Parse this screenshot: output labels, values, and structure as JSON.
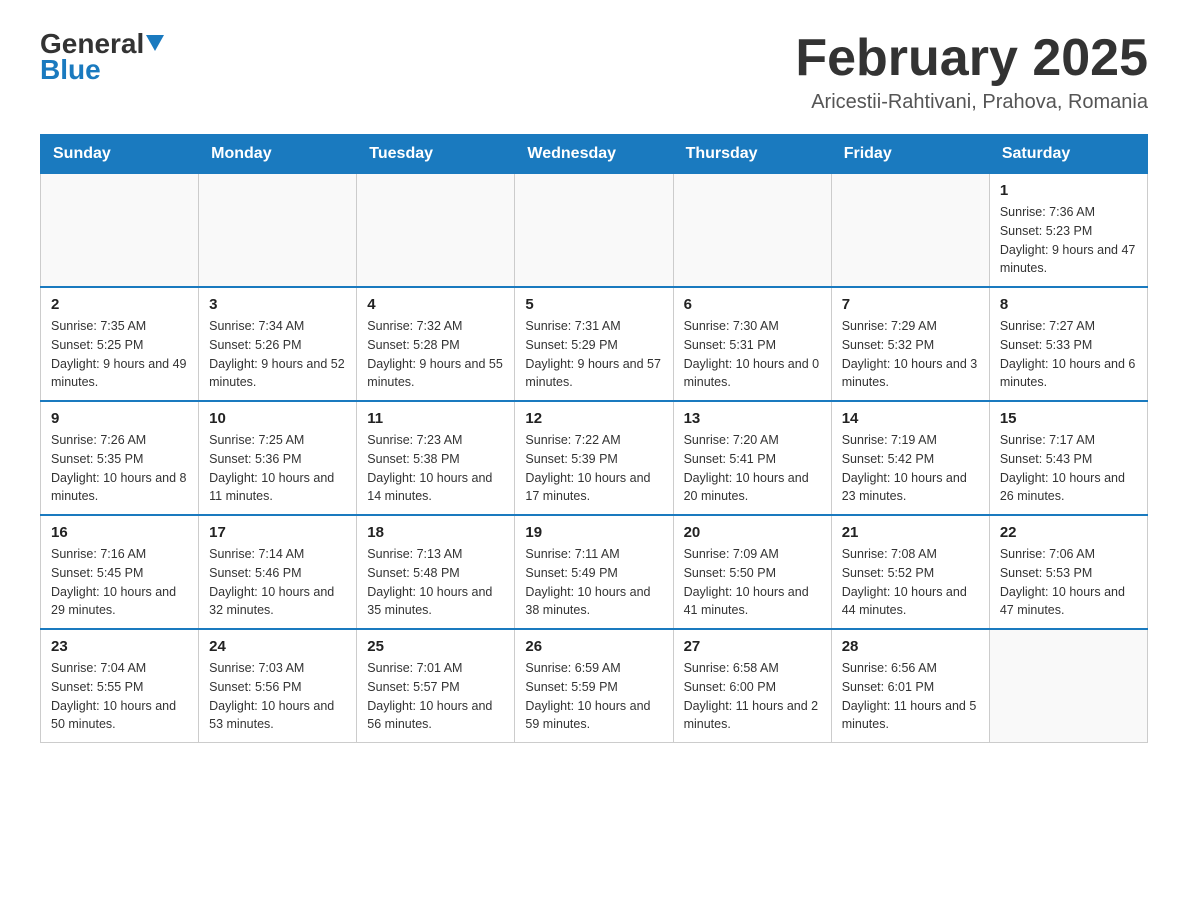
{
  "header": {
    "logo_general": "General",
    "logo_blue": "Blue",
    "month_title": "February 2025",
    "location": "Aricestii-Rahtivani, Prahova, Romania"
  },
  "weekdays": [
    "Sunday",
    "Monday",
    "Tuesday",
    "Wednesday",
    "Thursday",
    "Friday",
    "Saturday"
  ],
  "weeks": [
    [
      {
        "day": "",
        "info": ""
      },
      {
        "day": "",
        "info": ""
      },
      {
        "day": "",
        "info": ""
      },
      {
        "day": "",
        "info": ""
      },
      {
        "day": "",
        "info": ""
      },
      {
        "day": "",
        "info": ""
      },
      {
        "day": "1",
        "info": "Sunrise: 7:36 AM\nSunset: 5:23 PM\nDaylight: 9 hours and 47 minutes."
      }
    ],
    [
      {
        "day": "2",
        "info": "Sunrise: 7:35 AM\nSunset: 5:25 PM\nDaylight: 9 hours and 49 minutes."
      },
      {
        "day": "3",
        "info": "Sunrise: 7:34 AM\nSunset: 5:26 PM\nDaylight: 9 hours and 52 minutes."
      },
      {
        "day": "4",
        "info": "Sunrise: 7:32 AM\nSunset: 5:28 PM\nDaylight: 9 hours and 55 minutes."
      },
      {
        "day": "5",
        "info": "Sunrise: 7:31 AM\nSunset: 5:29 PM\nDaylight: 9 hours and 57 minutes."
      },
      {
        "day": "6",
        "info": "Sunrise: 7:30 AM\nSunset: 5:31 PM\nDaylight: 10 hours and 0 minutes."
      },
      {
        "day": "7",
        "info": "Sunrise: 7:29 AM\nSunset: 5:32 PM\nDaylight: 10 hours and 3 minutes."
      },
      {
        "day": "8",
        "info": "Sunrise: 7:27 AM\nSunset: 5:33 PM\nDaylight: 10 hours and 6 minutes."
      }
    ],
    [
      {
        "day": "9",
        "info": "Sunrise: 7:26 AM\nSunset: 5:35 PM\nDaylight: 10 hours and 8 minutes."
      },
      {
        "day": "10",
        "info": "Sunrise: 7:25 AM\nSunset: 5:36 PM\nDaylight: 10 hours and 11 minutes."
      },
      {
        "day": "11",
        "info": "Sunrise: 7:23 AM\nSunset: 5:38 PM\nDaylight: 10 hours and 14 minutes."
      },
      {
        "day": "12",
        "info": "Sunrise: 7:22 AM\nSunset: 5:39 PM\nDaylight: 10 hours and 17 minutes."
      },
      {
        "day": "13",
        "info": "Sunrise: 7:20 AM\nSunset: 5:41 PM\nDaylight: 10 hours and 20 minutes."
      },
      {
        "day": "14",
        "info": "Sunrise: 7:19 AM\nSunset: 5:42 PM\nDaylight: 10 hours and 23 minutes."
      },
      {
        "day": "15",
        "info": "Sunrise: 7:17 AM\nSunset: 5:43 PM\nDaylight: 10 hours and 26 minutes."
      }
    ],
    [
      {
        "day": "16",
        "info": "Sunrise: 7:16 AM\nSunset: 5:45 PM\nDaylight: 10 hours and 29 minutes."
      },
      {
        "day": "17",
        "info": "Sunrise: 7:14 AM\nSunset: 5:46 PM\nDaylight: 10 hours and 32 minutes."
      },
      {
        "day": "18",
        "info": "Sunrise: 7:13 AM\nSunset: 5:48 PM\nDaylight: 10 hours and 35 minutes."
      },
      {
        "day": "19",
        "info": "Sunrise: 7:11 AM\nSunset: 5:49 PM\nDaylight: 10 hours and 38 minutes."
      },
      {
        "day": "20",
        "info": "Sunrise: 7:09 AM\nSunset: 5:50 PM\nDaylight: 10 hours and 41 minutes."
      },
      {
        "day": "21",
        "info": "Sunrise: 7:08 AM\nSunset: 5:52 PM\nDaylight: 10 hours and 44 minutes."
      },
      {
        "day": "22",
        "info": "Sunrise: 7:06 AM\nSunset: 5:53 PM\nDaylight: 10 hours and 47 minutes."
      }
    ],
    [
      {
        "day": "23",
        "info": "Sunrise: 7:04 AM\nSunset: 5:55 PM\nDaylight: 10 hours and 50 minutes."
      },
      {
        "day": "24",
        "info": "Sunrise: 7:03 AM\nSunset: 5:56 PM\nDaylight: 10 hours and 53 minutes."
      },
      {
        "day": "25",
        "info": "Sunrise: 7:01 AM\nSunset: 5:57 PM\nDaylight: 10 hours and 56 minutes."
      },
      {
        "day": "26",
        "info": "Sunrise: 6:59 AM\nSunset: 5:59 PM\nDaylight: 10 hours and 59 minutes."
      },
      {
        "day": "27",
        "info": "Sunrise: 6:58 AM\nSunset: 6:00 PM\nDaylight: 11 hours and 2 minutes."
      },
      {
        "day": "28",
        "info": "Sunrise: 6:56 AM\nSunset: 6:01 PM\nDaylight: 11 hours and 5 minutes."
      },
      {
        "day": "",
        "info": ""
      }
    ]
  ]
}
